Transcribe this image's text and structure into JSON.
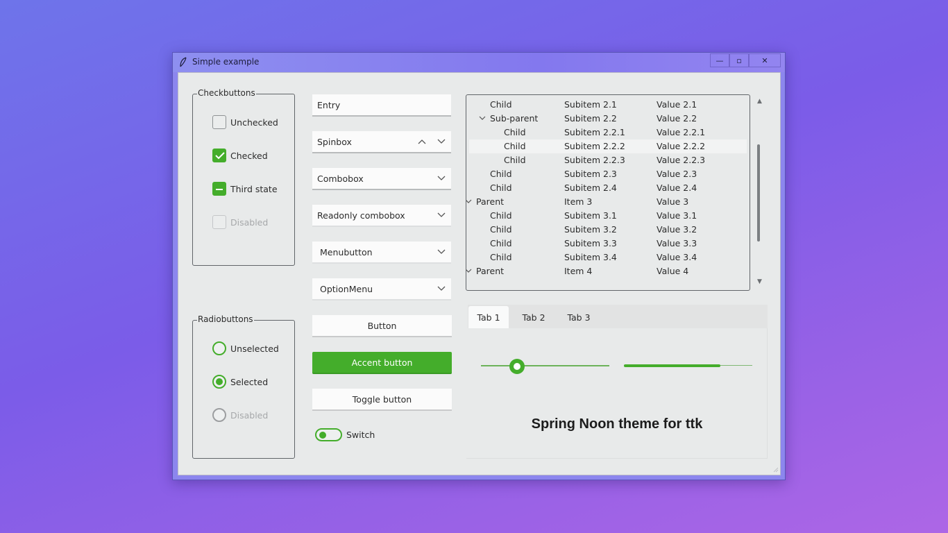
{
  "window": {
    "title": "Simple example",
    "controls": {
      "minimize": "—",
      "maximize": "▫",
      "close": "✕"
    }
  },
  "checkbuttons": {
    "title": "Checkbuttons",
    "items": [
      {
        "label": "Unchecked",
        "state": "unchecked"
      },
      {
        "label": "Checked",
        "state": "checked"
      },
      {
        "label": "Third state",
        "state": "indeterminate"
      },
      {
        "label": "Disabled",
        "state": "disabled"
      }
    ]
  },
  "radiobuttons": {
    "title": "Radiobuttons",
    "items": [
      {
        "label": "Unselected",
        "state": "unselected"
      },
      {
        "label": "Selected",
        "state": "selected"
      },
      {
        "label": "Disabled",
        "state": "disabled"
      }
    ]
  },
  "widgets": {
    "entry": "Entry",
    "spinbox": "Spinbox",
    "combobox": "Combobox",
    "readonly_combobox": "Readonly combobox",
    "menubutton": "Menubutton",
    "optionmenu": "OptionMenu",
    "button": "Button",
    "accent_button": "Accent button",
    "toggle_button": "Toggle button",
    "switch": "Switch"
  },
  "tree": {
    "rows": [
      {
        "name": "Child",
        "col2": "Subitem 2.1",
        "col3": "Value 2.1",
        "indent": 2,
        "expander": false
      },
      {
        "name": "Sub-parent",
        "col2": "Subitem 2.2",
        "col3": "Value 2.2",
        "indent": 2,
        "expander": true
      },
      {
        "name": "Child",
        "col2": "Subitem 2.2.1",
        "col3": "Value 2.2.1",
        "indent": 3,
        "expander": false
      },
      {
        "name": "Child",
        "col2": "Subitem 2.2.2",
        "col3": "Value 2.2.2",
        "indent": 3,
        "expander": false,
        "highlighted": true
      },
      {
        "name": "Child",
        "col2": "Subitem 2.2.3",
        "col3": "Value 2.2.3",
        "indent": 3,
        "expander": false
      },
      {
        "name": "Child",
        "col2": "Subitem 2.3",
        "col3": "Value 2.3",
        "indent": 2,
        "expander": false
      },
      {
        "name": "Child",
        "col2": "Subitem 2.4",
        "col3": "Value 2.4",
        "indent": 2,
        "expander": false
      },
      {
        "name": "Parent",
        "col2": "Item 3",
        "col3": "Value 3",
        "indent": 1,
        "expander": true
      },
      {
        "name": "Child",
        "col2": "Subitem 3.1",
        "col3": "Value 3.1",
        "indent": 2,
        "expander": false
      },
      {
        "name": "Child",
        "col2": "Subitem 3.2",
        "col3": "Value 3.2",
        "indent": 2,
        "expander": false
      },
      {
        "name": "Child",
        "col2": "Subitem 3.3",
        "col3": "Value 3.3",
        "indent": 2,
        "expander": false
      },
      {
        "name": "Child",
        "col2": "Subitem 3.4",
        "col3": "Value 3.4",
        "indent": 2,
        "expander": false
      },
      {
        "name": "Parent",
        "col2": "Item 4",
        "col3": "Value 4",
        "indent": 1,
        "expander": true
      }
    ],
    "scroll_up": "▲",
    "scroll_down": "▼"
  },
  "notebook": {
    "tabs": [
      "Tab 1",
      "Tab 2",
      "Tab 3"
    ],
    "active_tab": 0,
    "scale_value": 0.28,
    "progress_value": 0.75,
    "label": "Spring Noon theme for ttk"
  },
  "colors": {
    "accent": "#44ad2b",
    "background": "#e8eaea"
  }
}
